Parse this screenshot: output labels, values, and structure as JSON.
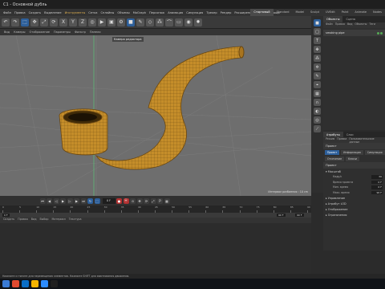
{
  "title": "C1 - Основной дубль",
  "menu": [
    "Файл",
    "Правка",
    "Создать",
    "Выделение",
    "Инструменты",
    "Сетка",
    "Сплайны",
    "Объемы",
    "MoGraph",
    "Персонаж",
    "Анимация",
    "Симуляция",
    "Трекер",
    "Рендер",
    "Расширения",
    "Окно",
    "Помощь"
  ],
  "menu_selected": "Инструменты",
  "layouts": [
    "Стартовый",
    "Standard",
    "Model",
    "Sculpt",
    "UVEdit",
    "Paint",
    "Animate",
    "Nodes"
  ],
  "layout_selected": "Стартовый",
  "view_menu": [
    "Вид",
    "Камеры",
    "Отображение",
    "Параметры",
    "Фильтр",
    "Панели"
  ],
  "viewport": {
    "camera_label": "Камера редактора",
    "grid_note": "Интервал разбиения : 10 cm"
  },
  "object_manager": {
    "tabs": [
      "Объекты",
      "Сцена"
    ],
    "tab_selected": "Объекты",
    "menu": [
      "Файл",
      "Правка",
      "Вид",
      "Объекты",
      "Теги"
    ],
    "objects": [
      {
        "name": "smoking pipe"
      }
    ]
  },
  "attributes": {
    "tabs": [
      "Атрибуты",
      "Слои"
    ],
    "tab_selected": "Атрибуты",
    "menu": [
      "Режим",
      "Правка",
      "Пользовательские данные"
    ],
    "title": "Проект",
    "sub_tabs": [
      "Проект",
      "Информация",
      "Симуляция",
      "Анимация"
    ],
    "sub_tab_selected": "Проект",
    "row2": [
      "Отсечение",
      "Ключи"
    ],
    "header": "Проект",
    "section_open": "Масштаб",
    "fields": [
      {
        "label": "Кадр/с",
        "value": "30"
      },
      {
        "label": "Время проекта",
        "value": "0 F"
      },
      {
        "label": "Мин. время",
        "value": "0 F"
      },
      {
        "label": "Макс. время",
        "value": "90 F"
      }
    ],
    "sections": [
      "Управление",
      "Атрибут LOD",
      "Отображение",
      "Ограничения"
    ]
  },
  "timeline": {
    "frame": "0 F",
    "ruler": [
      "0",
      "5",
      "10",
      "15",
      "20",
      "25",
      "30",
      "35",
      "40",
      "45",
      "50",
      "55",
      "60",
      "65",
      "70",
      "75",
      "80",
      "85",
      "90"
    ],
    "range_start": "0 F",
    "range_end": "90 F",
    "range_end2": "90 F"
  },
  "materials": {
    "menu": [
      "Создать",
      "Правка",
      "Вид",
      "Выбор",
      "Материал",
      "Текстура"
    ]
  },
  "status": "Нажмите и тяните для перемещения элементов. Нажмите SHIFT для квантования движения.",
  "taskbar_colors": [
    "#3a7bd5",
    "#e04a2f",
    "#0a6ec6",
    "#f5b400",
    "#2d8cff",
    "#202020"
  ]
}
